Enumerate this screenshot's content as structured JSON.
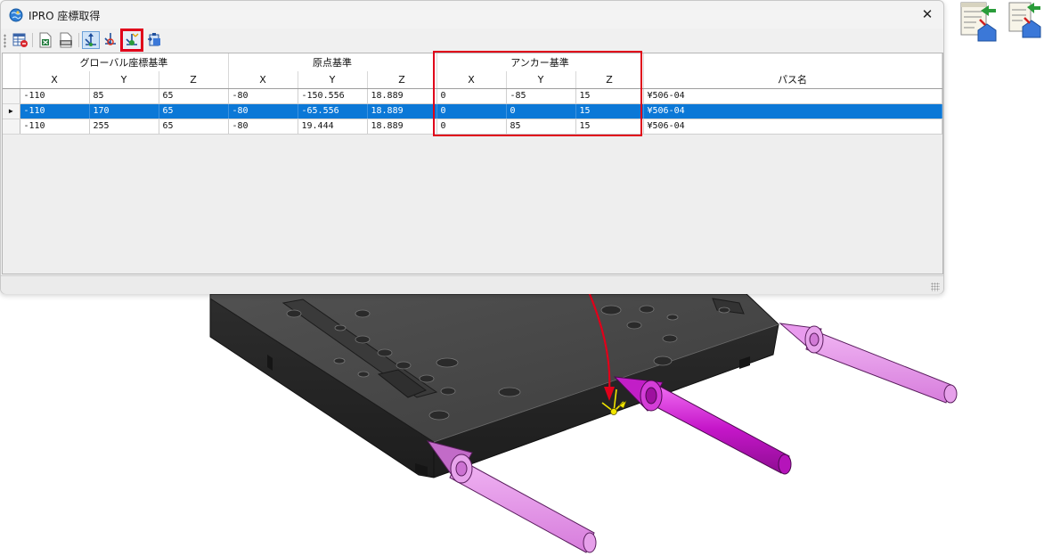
{
  "window": {
    "title": "IPRO 座標取得",
    "close_glyph": "✕"
  },
  "toolbar": {
    "buttons": [
      {
        "name": "table-settings-icon"
      },
      {
        "name": "export-excel-icon"
      },
      {
        "name": "export-csv-icon"
      },
      {
        "name": "global-coord-icon"
      },
      {
        "name": "origin-coord-icon"
      },
      {
        "name": "anchor-coord-icon",
        "highlighted": true
      },
      {
        "name": "copy-clipboard-icon"
      }
    ]
  },
  "grid": {
    "groups": [
      {
        "label": "グローバル座標基準",
        "span": 3
      },
      {
        "label": "原点基準",
        "span": 3
      },
      {
        "label": "アンカー基準",
        "span": 3
      },
      {
        "label": "",
        "span": 1
      }
    ],
    "columns": [
      "X",
      "Y",
      "Z",
      "X",
      "Y",
      "Z",
      "X",
      "Y",
      "Z",
      "パス名"
    ],
    "rows": [
      {
        "cells": [
          "-110",
          "85",
          "65",
          "-80",
          "-150.556",
          "18.889",
          "0",
          "-85",
          "15",
          "¥506-04"
        ],
        "selected": false
      },
      {
        "cells": [
          "-110",
          "170",
          "65",
          "-80",
          "-65.556",
          "18.889",
          "0",
          "0",
          "15",
          "¥506-04"
        ],
        "selected": true
      },
      {
        "cells": [
          "-110",
          "255",
          "65",
          "-80",
          "19.444",
          "18.889",
          "0",
          "85",
          "15",
          "¥506-04"
        ],
        "selected": false
      }
    ],
    "current_row_marker": "▶"
  },
  "desktop_icons": [
    {
      "name": "coord-table-app-icon"
    },
    {
      "name": "coord-export-app-icon"
    }
  ],
  "colors": {
    "selection": "#0b78d7",
    "annotation": "#e0001a",
    "plate": "#4a4a4a",
    "arrow_light": "#e08ae8",
    "arrow_strong": "#d21fd6",
    "anchor_marker": "#f2e600"
  }
}
